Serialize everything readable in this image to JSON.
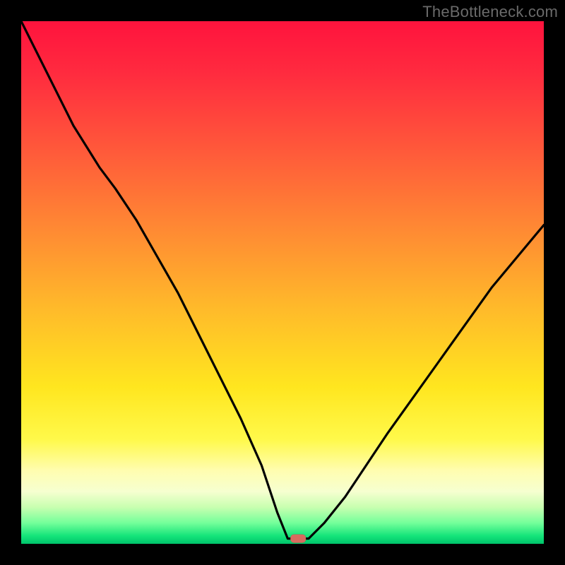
{
  "watermark": "TheBottleneck.com",
  "colors": {
    "frame": "#000000",
    "curve": "#000000",
    "marker": "#d86b5f",
    "gradient_top": "#ff133d",
    "gradient_bottom": "#00c46b"
  },
  "chart_data": {
    "type": "line",
    "title": "",
    "xlabel": "",
    "ylabel": "",
    "xlim": [
      0,
      100
    ],
    "ylim": [
      0,
      100
    ],
    "grid": false,
    "series": [
      {
        "name": "bottleneck-curve",
        "x": [
          0,
          5,
          10,
          15,
          18,
          22,
          26,
          30,
          34,
          38,
          42,
          46,
          49,
          51,
          53,
          55,
          58,
          62,
          66,
          70,
          75,
          80,
          85,
          90,
          95,
          100
        ],
        "y": [
          100,
          90,
          80,
          72,
          68,
          62,
          55,
          48,
          40,
          32,
          24,
          15,
          6,
          1,
          1,
          1,
          4,
          9,
          15,
          21,
          28,
          35,
          42,
          49,
          55,
          61
        ]
      }
    ],
    "marker": {
      "x": 53,
      "y": 1,
      "shape": "rounded-rect"
    },
    "notes": "Axis scales are unlabeled in the source image; values are estimated on a 0–100 normalized scale read from the plot footprint. The curve has a sharp V with its minimum plateau near x≈51–55 at y≈1, steeper on the left branch than the right."
  }
}
